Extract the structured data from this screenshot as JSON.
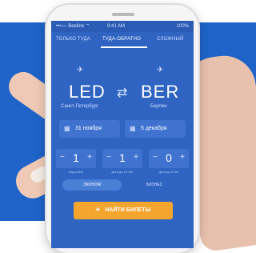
{
  "colors": {
    "band": "#1f63c8",
    "screen": "#2f64c2",
    "accent": "#f4a52d"
  },
  "status": {
    "carrier": "•••○○ Beeline ⌔",
    "time": "9:41 AM",
    "battery": "100%"
  },
  "tabs": [
    {
      "label": "ТОЛЬКО ТУДА",
      "active": false
    },
    {
      "label": "ТУДА-ОБРАТНО",
      "active": true
    },
    {
      "label": "СЛОЖНЫЙ",
      "active": false
    }
  ],
  "route": {
    "from_code": "LED",
    "to_code": "BER",
    "from_city": "Санкт-Петербург",
    "to_city": "Берлин"
  },
  "dates": {
    "depart": "31 ноября",
    "return": "5 декабря"
  },
  "passengers": [
    {
      "value": "1",
      "label": "взрослые"
    },
    {
      "value": "1",
      "label": "дети до 12 лет"
    },
    {
      "value": "0",
      "label": "дети до 2 лет"
    }
  ],
  "classes": [
    {
      "label": "ЭКОНОМ",
      "active": true
    },
    {
      "label": "БИЗНЕС",
      "active": false
    }
  ],
  "search_button": "НАЙТИ БИЛЕТЫ",
  "icons": {
    "depart": "plane-takeoff-icon",
    "arrive": "plane-landing-icon",
    "swap": "swap-icon",
    "calendar": "calendar-icon",
    "minus": "minus-icon",
    "plus": "plus-icon",
    "search_plane": "plane-icon"
  }
}
